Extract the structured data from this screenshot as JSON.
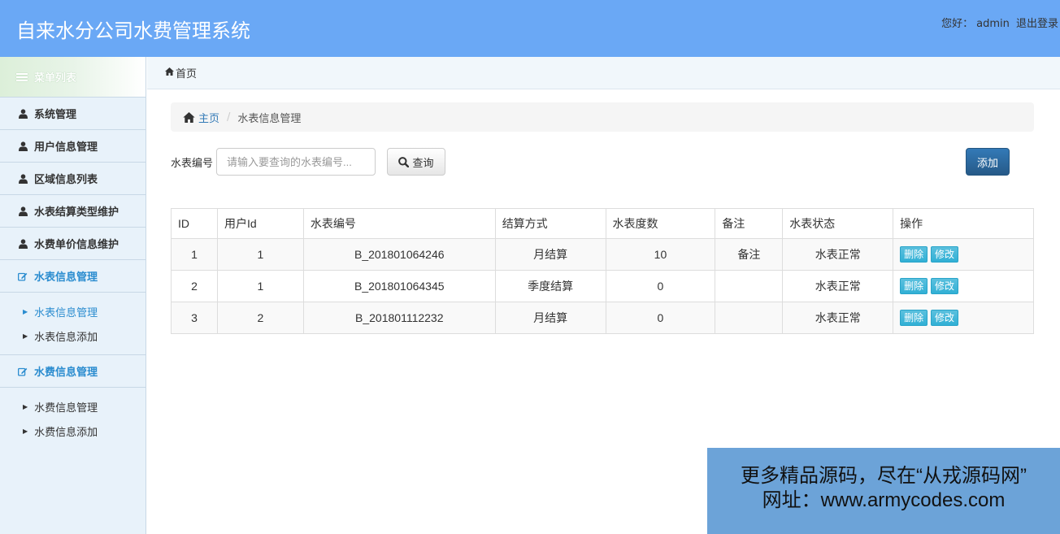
{
  "header": {
    "title": "自来水分公司水费管理系统",
    "greeting": "您好：",
    "username": "admin",
    "logout": "退出登录"
  },
  "sidebar": {
    "head": "菜单列表",
    "items": [
      {
        "label": "系统管理",
        "icon": "user-icon"
      },
      {
        "label": "用户信息管理",
        "icon": "user-icon"
      },
      {
        "label": "区域信息列表",
        "icon": "user-icon"
      },
      {
        "label": "水表结算类型维护",
        "icon": "user-icon"
      },
      {
        "label": "水费单价信息维护",
        "icon": "user-icon"
      }
    ],
    "sections": [
      {
        "label": "水表信息管理",
        "icon": "edit-icon",
        "children": [
          "水表信息管理",
          "水表信息添加"
        ]
      },
      {
        "label": "水费信息管理",
        "icon": "edit-icon",
        "children": [
          "水费信息管理",
          "水费信息添加"
        ]
      }
    ]
  },
  "topcrumb": "首页",
  "breadcrumb": {
    "home": "主页",
    "current": "水表信息管理"
  },
  "search": {
    "label": "水表编号",
    "placeholder": "请输入要查询的水表编号...",
    "button": "查询",
    "add": "添加"
  },
  "table": {
    "columns": [
      "ID",
      "用户Id",
      "水表编号",
      "结算方式",
      "水表度数",
      "备注",
      "水表状态",
      "操作"
    ],
    "rows": [
      [
        "1",
        "1",
        "B_201801064246",
        "月结算",
        "10",
        "备注",
        "水表正常"
      ],
      [
        "2",
        "1",
        "B_201801064345",
        "季度结算",
        "0",
        "",
        "水表正常"
      ],
      [
        "3",
        "2",
        "B_201801112232",
        "月结算",
        "0",
        "",
        "水表正常"
      ]
    ],
    "delete_label": "删除",
    "edit_label": "修改"
  },
  "watermark": {
    "line1": "更多精品源码，尽在“从戎源码网”",
    "line2": "网址：www.armycodes.com"
  },
  "colors": {
    "header": "#6aa8f5",
    "primary": "#337ab7",
    "info": "#5bc0de",
    "sidebar": "#e8f2fa",
    "accent": "#2a8ccf"
  }
}
